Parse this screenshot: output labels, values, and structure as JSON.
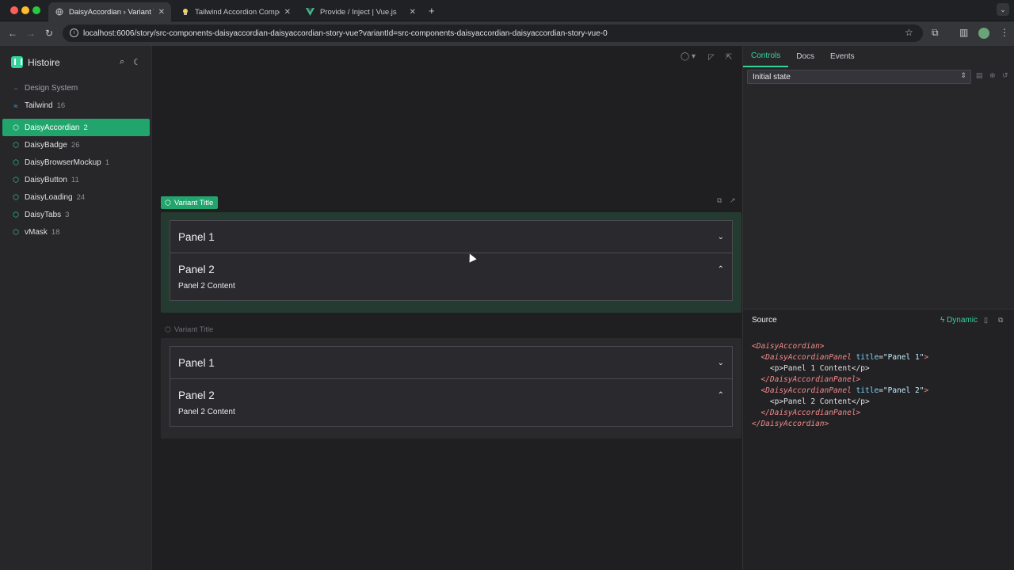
{
  "browser": {
    "tabs": [
      {
        "title": "DaisyAccordian › Variant Title"
      },
      {
        "title": "Tailwind Accordion Component"
      },
      {
        "title": "Provide / Inject | Vue.js"
      }
    ],
    "url": "localhost:6006/story/src-components-daisyaccordian-daisyaccordian-story-vue?variantId=src-components-daisyaccordian-daisyaccordian-story-vue-0"
  },
  "sidebar": {
    "app_name": "Histoire",
    "groups": [
      {
        "label": "Design System"
      },
      {
        "label": "Tailwind",
        "count": "16"
      }
    ],
    "items": [
      {
        "label": "DaisyAccordian",
        "count": "2"
      },
      {
        "label": "DaisyBadge",
        "count": "26"
      },
      {
        "label": "DaisyBrowserMockup",
        "count": "1"
      },
      {
        "label": "DaisyButton",
        "count": "11"
      },
      {
        "label": "DaisyLoading",
        "count": "24"
      },
      {
        "label": "DaisyTabs",
        "count": "3"
      },
      {
        "label": "vMask",
        "count": "18"
      }
    ]
  },
  "main": {
    "variants": [
      {
        "title": "Variant Title",
        "panels": [
          {
            "title": "Panel 1",
            "content": ""
          },
          {
            "title": "Panel 2",
            "content": "Panel 2 Content"
          }
        ]
      },
      {
        "title": "Variant Title",
        "panels": [
          {
            "title": "Panel 1",
            "content": ""
          },
          {
            "title": "Panel 2",
            "content": "Panel 2 Content"
          }
        ]
      }
    ]
  },
  "rightpane": {
    "tabs": [
      "Controls",
      "Docs",
      "Events"
    ],
    "state_select": "Initial state",
    "source_title": "Source",
    "dynamic_label": "Dynamic"
  },
  "colors": {
    "accent": "#22a56d",
    "accent_text": "#34d399"
  }
}
